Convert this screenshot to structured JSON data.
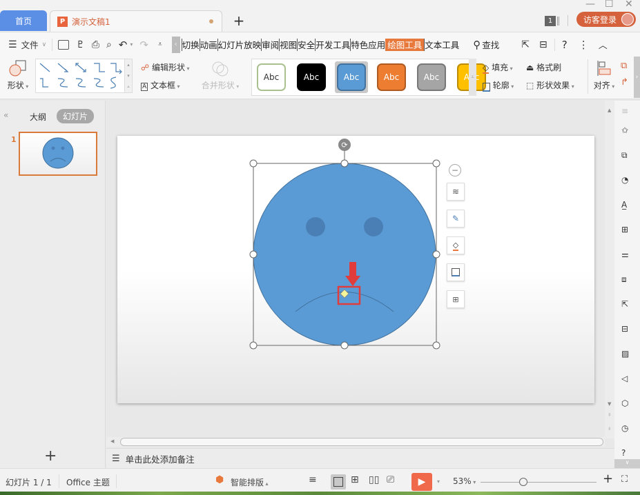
{
  "titlebar": {
    "home_tab": "首页",
    "doc_tab": "演示文稿1",
    "doc_icon": "P",
    "badge_count": "1",
    "login_button": "访客登录",
    "window_controls": {
      "minimize": "—",
      "maximize": "☐",
      "close": "✕"
    }
  },
  "menu": {
    "file_label": "文件",
    "ribbon_tabs": [
      "切换",
      "动画",
      "幻灯片放映",
      "审阅",
      "视图",
      "安全",
      "开发工具",
      "特色应用",
      "绘图工具",
      "文本工具"
    ],
    "active_tab": "绘图工具",
    "search_label": "查找"
  },
  "ribbon": {
    "shape_label": "形状",
    "edit_shape": "编辑形状",
    "text_box": "文本框",
    "merge_shape": "合并形状",
    "style_swatches": [
      {
        "label": "Abc",
        "bg": "#ffffff",
        "fg": "#333333",
        "border": "#a9c08f"
      },
      {
        "label": "Abc",
        "bg": "#000000",
        "fg": "#ffffff",
        "border": "#000000"
      },
      {
        "label": "Abc",
        "bg": "#5b9bd5",
        "fg": "#ffffff",
        "border": "#41719c"
      },
      {
        "label": "Abc",
        "bg": "#ed7d31",
        "fg": "#ffffff",
        "border": "#ae5a21"
      },
      {
        "label": "Abc",
        "bg": "#a5a5a5",
        "fg": "#ffffff",
        "border": "#787878"
      },
      {
        "label": "Abc",
        "bg": "#ffc000",
        "fg": "#ffffff",
        "border": "#bc8c00"
      }
    ],
    "fill": "填充",
    "format_painter": "格式刷",
    "outline": "轮廓",
    "shape_effects": "形状效果",
    "align": "对齐"
  },
  "left_panel": {
    "outline_tab": "大纲",
    "slides_tab": "幻灯片",
    "slide_number": "1"
  },
  "notes": {
    "placeholder": "单击此处添加备注"
  },
  "status": {
    "slide_info": "幻灯片 1 / 1",
    "theme": "Office 主题",
    "smart_layout": "智能排版",
    "zoom": "53%"
  },
  "colors": {
    "accent": "#e8793c",
    "face_fill": "#5b9bd5",
    "eye_fill": "#4a7fb5",
    "highlight_red": "#e03c3c",
    "play_button": "#f0694a"
  }
}
